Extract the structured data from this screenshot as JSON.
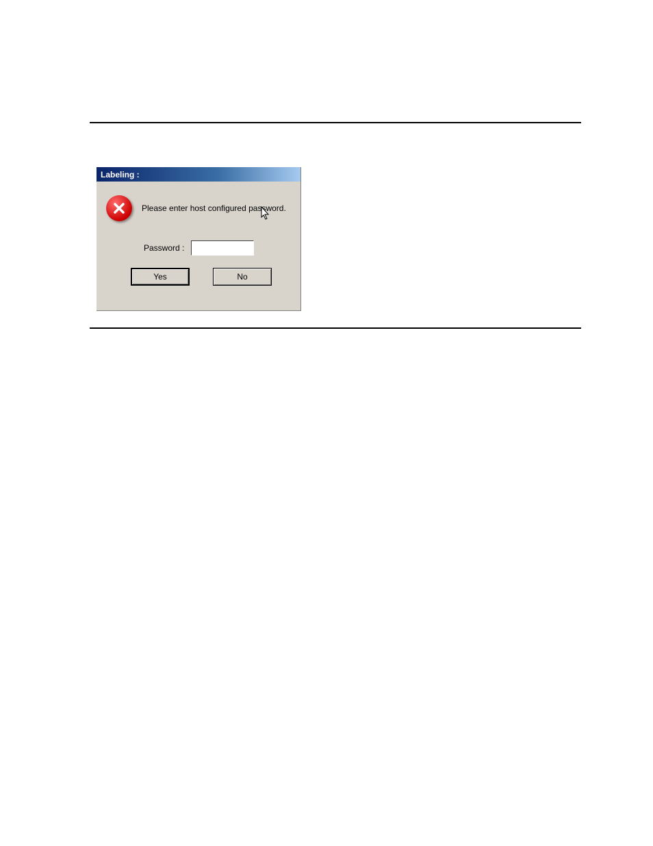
{
  "dialog": {
    "title": "Labeling :",
    "message": "Please enter host configured password.",
    "password_label": "Password :",
    "password_value": "",
    "yes_label": "Yes",
    "no_label": "No",
    "icon": "error-icon"
  }
}
